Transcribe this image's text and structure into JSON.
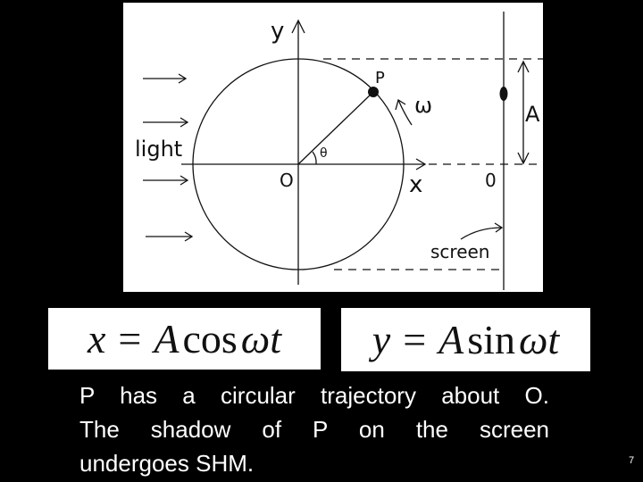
{
  "diagram": {
    "labels": {
      "y_axis": "y",
      "x_axis": "x",
      "origin": "O",
      "point": "P",
      "angle": "θ",
      "angular_velocity": "ω",
      "light": "light",
      "amplitude": "A",
      "screen_origin": "0",
      "screen": "screen"
    },
    "light_arrow_count": 4
  },
  "formulas": {
    "x": {
      "lhs": "x",
      "eq": "=",
      "amp": "A",
      "fn": "cos",
      "arg": "ωt"
    },
    "y": {
      "lhs": "y",
      "eq": "=",
      "amp": "A",
      "fn": "sin",
      "arg": "ωt"
    }
  },
  "caption": {
    "line1": "P has a circular trajectory about O.",
    "line2": "The shadow of P on the screen",
    "line3": "undergoes SHM."
  },
  "page_number": "7"
}
